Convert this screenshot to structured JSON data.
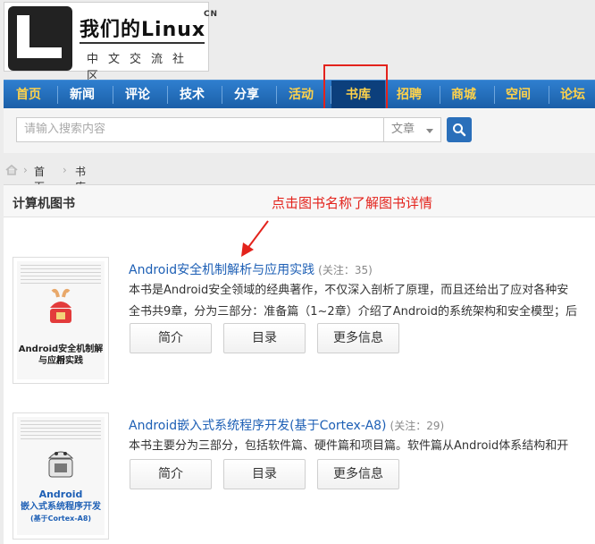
{
  "logo": {
    "title_cn": "我们的",
    "title_latin": "Linux",
    "superscript": "CN",
    "subtitle": "中文交流社区"
  },
  "nav": {
    "items": [
      {
        "label": "首页",
        "style": "gold"
      },
      {
        "label": "新闻",
        "style": "white"
      },
      {
        "label": "评论",
        "style": "white"
      },
      {
        "label": "技术",
        "style": "white"
      },
      {
        "label": "分享",
        "style": "white"
      },
      {
        "label": "活动",
        "style": "gold"
      },
      {
        "label": "书库",
        "style": "active"
      },
      {
        "label": "招聘",
        "style": "gold"
      },
      {
        "label": "商城",
        "style": "gold"
      },
      {
        "label": "空间",
        "style": "gold"
      },
      {
        "label": "论坛",
        "style": "gold"
      }
    ]
  },
  "search": {
    "placeholder": "请输入搜索内容",
    "scope": "文章",
    "button_icon": "search-icon"
  },
  "breadcrumb": {
    "home_icon": "home-icon",
    "home": "首页",
    "current": "书库"
  },
  "section": {
    "title": "计算机图书",
    "annotation": "点击图书名称了解图书详情"
  },
  "books": [
    {
      "title": "Android安全机制解析与应用实践",
      "attention": "(关注：35)",
      "desc_lines": [
        "本书是Android安全领域的经典著作，不仅深入剖析了原理，而且还给出了应对各种安",
        "全书共9章，分为三部分：准备篇（1~2章）介绍了Android的系统架构和安全模型；后"
      ],
      "cover_title": [
        "Android安全机制解析",
        "与应用实践"
      ],
      "buttons": [
        "简介",
        "目录",
        "更多信息"
      ]
    },
    {
      "title": "Android嵌入式系统程序开发(基于Cortex-A8)",
      "attention": "(关注：29)",
      "desc_lines": [
        "本书主要分为三部分，包括软件篇、硬件篇和项目篇。软件篇从Android体系结构和开"
      ],
      "cover_title": [
        "Android",
        "嵌入式系统程序开发",
        "(基于Cortex-A8)"
      ],
      "buttons": [
        "简介",
        "目录",
        "更多信息"
      ]
    }
  ],
  "colors": {
    "nav_bg": "#1b5fa8",
    "nav_gold": "#ffd24a",
    "link_blue": "#1d5fb5",
    "annotation_red": "#e3231c"
  }
}
